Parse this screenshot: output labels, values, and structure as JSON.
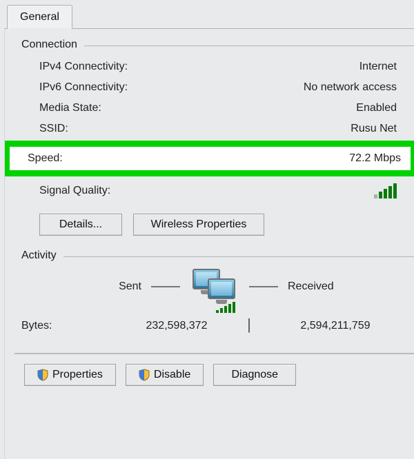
{
  "tab": {
    "label": "General"
  },
  "connection": {
    "title": "Connection",
    "ipv4_label": "IPv4 Connectivity:",
    "ipv4_value": "Internet",
    "ipv6_label": "IPv6 Connectivity:",
    "ipv6_value": "No network access",
    "media_label": "Media State:",
    "media_value": "Enabled",
    "ssid_label": "SSID:",
    "ssid_value": "Rusu Net",
    "speed_label": "Speed:",
    "speed_value": "72.2 Mbps",
    "signal_label": "Signal Quality:"
  },
  "buttons": {
    "details": "Details...",
    "wireless": "Wireless Properties",
    "properties": "Properties",
    "disable": "Disable",
    "diagnose": "Diagnose"
  },
  "activity": {
    "title": "Activity",
    "sent_label": "Sent",
    "received_label": "Received",
    "bytes_label": "Bytes:",
    "bytes_sent": "232,598,372",
    "bytes_received": "2,594,211,759",
    "separator": "|"
  }
}
